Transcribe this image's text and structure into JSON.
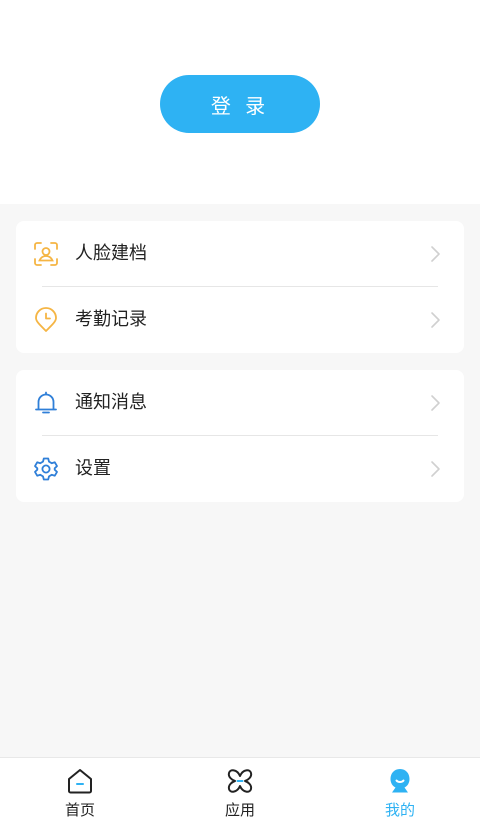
{
  "header": {
    "login_label": "登 录"
  },
  "menu_group_1": [
    {
      "label": "人脸建档",
      "icon": "face-profile-icon",
      "color": "#f5b544"
    },
    {
      "label": "考勤记录",
      "icon": "clock-icon",
      "color": "#f5b544"
    }
  ],
  "menu_group_2": [
    {
      "label": "通知消息",
      "icon": "bell-icon",
      "color": "#2f7fd8"
    },
    {
      "label": "设置",
      "icon": "gear-icon",
      "color": "#2f7fd8"
    }
  ],
  "tabbar": {
    "items": [
      {
        "label": "首页",
        "icon": "home-icon",
        "active": false
      },
      {
        "label": "应用",
        "icon": "apps-icon",
        "active": false
      },
      {
        "label": "我的",
        "icon": "profile-icon",
        "active": true
      }
    ]
  },
  "colors": {
    "accent": "#2eb2f3",
    "orange_icon": "#f5b544",
    "blue_icon": "#2f7fd8"
  }
}
